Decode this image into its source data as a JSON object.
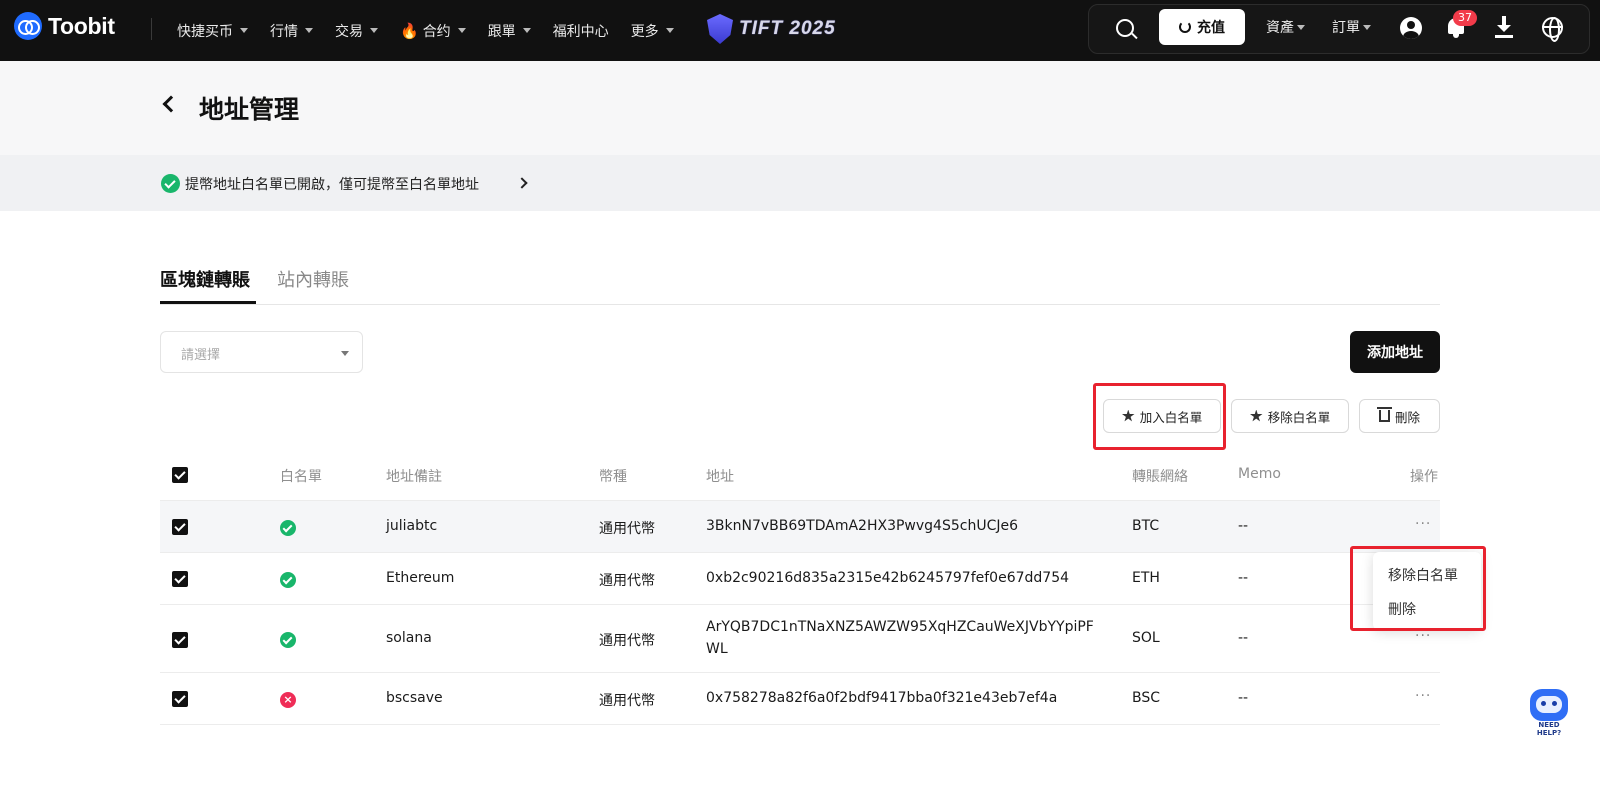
{
  "nav": {
    "logo": "Toobit",
    "items": [
      {
        "label": "快捷买币",
        "caret": true
      },
      {
        "label": "行情",
        "caret": true
      },
      {
        "label": "交易",
        "caret": true
      },
      {
        "label": "合约",
        "caret": true,
        "fire": true
      },
      {
        "label": "跟單",
        "caret": true
      },
      {
        "label": "福利中心",
        "caret": false
      },
      {
        "label": "更多",
        "caret": true
      }
    ],
    "event_banner": "TIFT 2025",
    "deposit_label": "充值",
    "assets_label": "資產",
    "orders_label": "訂單",
    "notification_count": "37",
    "accent_color": "#1f6bff"
  },
  "page": {
    "title": "地址管理",
    "notice": "提幣地址白名單已開啟，僅可提幣至白名單地址"
  },
  "tabs": [
    {
      "label": "區塊鏈轉賬",
      "active": true
    },
    {
      "label": "站內轉賬",
      "active": false
    }
  ],
  "filter": {
    "placeholder": "請選擇"
  },
  "actions": {
    "add_address": "添加地址",
    "add_whitelist": "加入白名單",
    "remove_whitelist": "移除白名單",
    "delete": "刪除"
  },
  "table": {
    "headers": {
      "whitelist": "白名單",
      "remark": "地址備註",
      "coin": "幣種",
      "address": "地址",
      "network": "轉賬網絡",
      "memo": "Memo",
      "operation": "操作"
    },
    "rows": [
      {
        "remark": "juliabtc",
        "coin": "通用代幣",
        "address": "3BknN7vBB69TDAmA2HX3Pwvg4S5chUCJe6",
        "network": "BTC",
        "memo": "--",
        "whitelisted": true,
        "checked": true
      },
      {
        "remark": "Ethereum",
        "coin": "通用代幣",
        "address": "0xb2c90216d835a2315e42b6245797fef0e67dd754",
        "network": "ETH",
        "memo": "--",
        "whitelisted": true,
        "checked": true
      },
      {
        "remark": "solana",
        "coin": "通用代幣",
        "address": "ArYQB7DC1nTNaXNZ5AWZW95XqHZCauWeXJVbYYpiPFWL",
        "network": "SOL",
        "memo": "--",
        "whitelisted": true,
        "checked": true
      },
      {
        "remark": "bscsave",
        "coin": "通用代幣",
        "address": "0x758278a82f6a0f2bdf9417bba0f321e43eb7ef4a",
        "network": "BSC",
        "memo": "--",
        "whitelisted": false,
        "checked": true
      }
    ],
    "more_label": "···"
  },
  "row_menu": {
    "items": [
      "移除白名單",
      "刪除"
    ]
  },
  "help_bot": {
    "label": "NEED HELP?"
  },
  "colors": {
    "highlight_box": "#e8222e",
    "whitelisted": "#19b66b",
    "not_whitelisted": "#ef2d57"
  }
}
